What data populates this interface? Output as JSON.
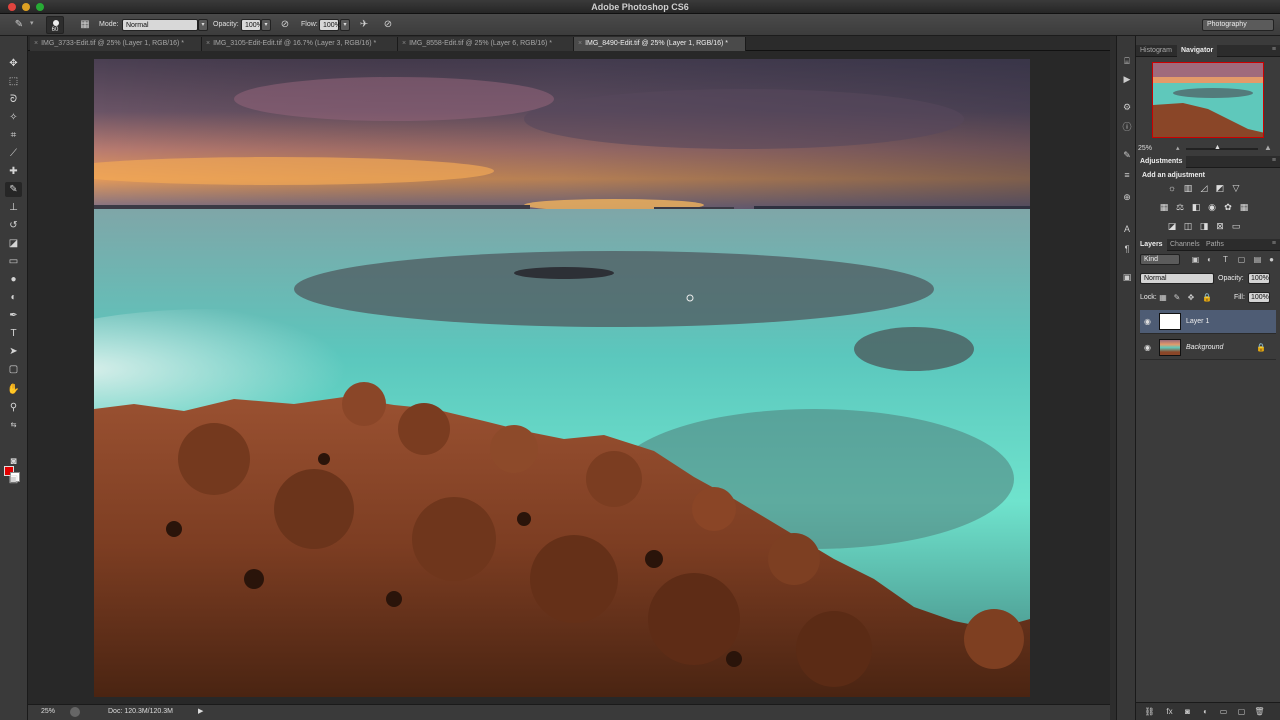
{
  "app": {
    "title": "Adobe Photoshop CS6"
  },
  "options_bar": {
    "brush_size": "60",
    "mode_label": "Mode:",
    "mode_value": "Normal",
    "opacity_label": "Opacity:",
    "opacity_value": "100%",
    "flow_label": "Flow:",
    "flow_value": "100%",
    "workspace": "Photography"
  },
  "tabs": [
    {
      "label": "IMG_3733-Edit.tif @ 25% (Layer 1, RGB/16) *",
      "active": false
    },
    {
      "label": "IMG_3105-Edit-Edit.tif @ 16.7% (Layer 3, RGB/16) *",
      "active": false
    },
    {
      "label": "IMG_8558-Edit.tif @ 25% (Layer 6, RGB/16) *",
      "active": false
    },
    {
      "label": "IMG_8490-Edit.tif @ 25% (Layer 1, RGB/16) *",
      "active": true
    }
  ],
  "tools": [
    "move-icon",
    "marquee-icon",
    "lasso-icon",
    "quick-select-icon",
    "crop-icon",
    "eyedropper-icon",
    "healing-icon",
    "brush-icon",
    "clone-stamp-icon",
    "history-brush-icon",
    "eraser-icon",
    "gradient-icon",
    "blur-icon",
    "dodge-icon",
    "pen-icon",
    "type-icon",
    "path-select-icon",
    "shape-icon",
    "hand-icon",
    "zoom-icon"
  ],
  "colors": {
    "foreground": "#e10000",
    "background": "#ffffff",
    "selection": "#4e5c74"
  },
  "status": {
    "zoom": "25%",
    "doc": "Doc: 120.3M/120.3M"
  },
  "navigator": {
    "tabs": [
      "Histogram",
      "Navigator"
    ],
    "active_tab": "Navigator",
    "zoom": "25%"
  },
  "adjustments": {
    "tab": "Adjustments",
    "heading": "Add an adjustment",
    "icons": [
      "brightness-icon",
      "levels-icon",
      "curves-icon",
      "exposure-icon",
      "vibrance-icon",
      "hue-saturation-icon",
      "color-balance-icon",
      "black-white-icon",
      "photo-filter-icon",
      "channel-mixer-icon",
      "color-lookup-icon",
      "invert-icon",
      "posterize-icon",
      "threshold-icon",
      "selective-color-icon",
      "gradient-map-icon"
    ]
  },
  "layers": {
    "tabs": [
      "Layers",
      "Channels",
      "Paths"
    ],
    "active_tab": "Layers",
    "filter": "Kind",
    "blend_mode": "Normal",
    "opacity_label": "Opacity:",
    "opacity_value": "100%",
    "lock_label": "Lock:",
    "fill_label": "Fill:",
    "fill_value": "100%",
    "items": [
      {
        "name": "Layer 1",
        "selected": true,
        "locked": false
      },
      {
        "name": "Background",
        "selected": false,
        "locked": true
      }
    ]
  }
}
